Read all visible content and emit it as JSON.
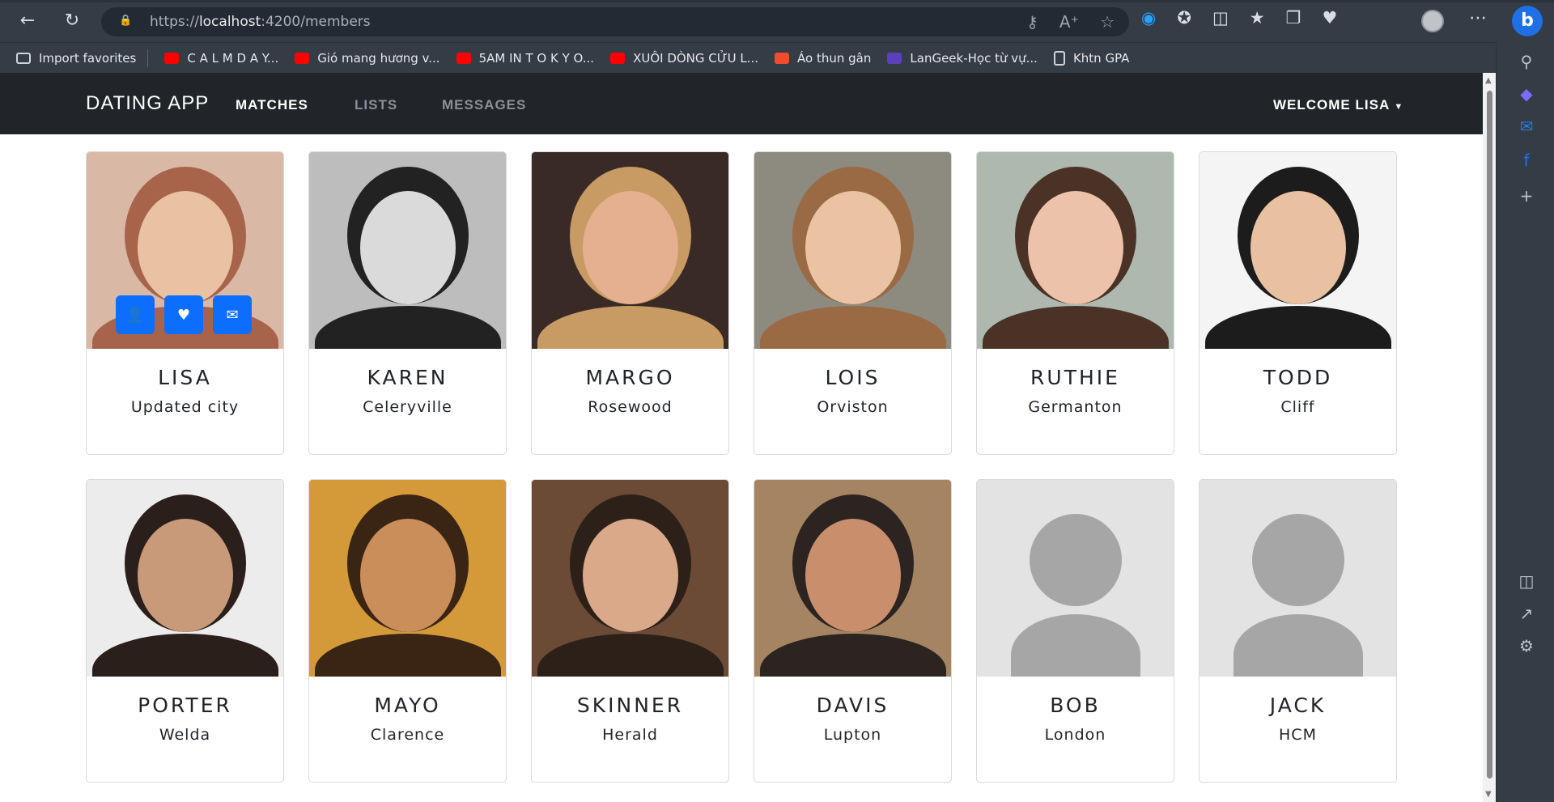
{
  "browser": {
    "url_prefix": "https://",
    "url_host": "localhost",
    "url_path": ":4200/members",
    "bookmarks": [
      {
        "label": "Import favorites",
        "kind": "import"
      },
      {
        "label": "C A L M    D A Y...",
        "kind": "yt"
      },
      {
        "label": "Gió mang hương v...",
        "kind": "yt"
      },
      {
        "label": "5AM IN  T O K Y O...",
        "kind": "yt"
      },
      {
        "label": "XUÔI DÒNG CỬU L...",
        "kind": "yt"
      },
      {
        "label": "Áo thun gân",
        "kind": "shop"
      },
      {
        "label": "LanGeek-Học từ vự...",
        "kind": "lang"
      },
      {
        "label": "Khtn GPA",
        "kind": "doc"
      }
    ]
  },
  "app": {
    "brand": "DATING APP",
    "nav": [
      "MATCHES",
      "LISTS",
      "MESSAGES"
    ],
    "welcome": "WELCOME LISA"
  },
  "members": [
    {
      "name": "LISA",
      "city": "Updated city",
      "skin": "#e8c2a3",
      "hair": "#a8644a",
      "bg": "#d9b9a6",
      "hover": true
    },
    {
      "name": "KAREN",
      "city": "Celeryville",
      "skin": "#dadada",
      "hair": "#222222",
      "bg": "#bdbdbd"
    },
    {
      "name": "MARGO",
      "city": "Rosewood",
      "skin": "#e4b08f",
      "hair": "#c89b64",
      "bg": "#3a2a25"
    },
    {
      "name": "LOIS",
      "city": "Orviston",
      "skin": "#e9c3a2",
      "hair": "#9a6a45",
      "bg": "#8d8a80"
    },
    {
      "name": "RUTHIE",
      "city": "Germanton",
      "skin": "#ecc3aa",
      "hair": "#4a3226",
      "bg": "#aeb8ae"
    },
    {
      "name": "TODD",
      "city": "Cliff",
      "skin": "#e8c1a1",
      "hair": "#1c1c1c",
      "bg": "#f4f4f4"
    },
    {
      "name": "PORTER",
      "city": "Welda",
      "skin": "#c99a79",
      "hair": "#2a1f1a",
      "bg": "#ececec"
    },
    {
      "name": "MAYO",
      "city": "Clarence",
      "skin": "#c98e5a",
      "hair": "#3a2414",
      "bg": "#d49a3a"
    },
    {
      "name": "SKINNER",
      "city": "Herald",
      "skin": "#d9a98a",
      "hair": "#2c2018",
      "bg": "#6b4b35"
    },
    {
      "name": "DAVIS",
      "city": "Lupton",
      "skin": "#c98f6c",
      "hair": "#2b2420",
      "bg": "#a58462"
    },
    {
      "name": "BOB",
      "city": "London",
      "placeholder": true
    },
    {
      "name": "JACK",
      "city": "HCM",
      "placeholder": true
    }
  ]
}
